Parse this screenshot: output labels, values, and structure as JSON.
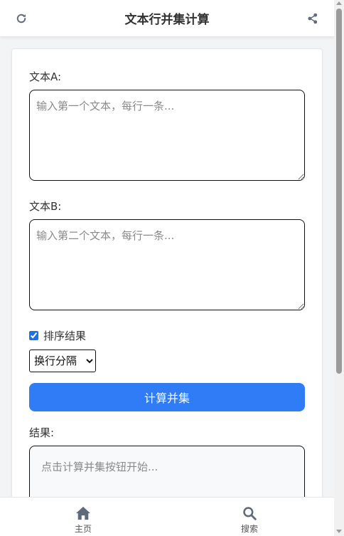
{
  "header": {
    "title": "文本行并集计算",
    "refresh_icon": "refresh-icon",
    "share_icon": "share-icon"
  },
  "form": {
    "text_a_label": "文本A:",
    "text_a_placeholder": "输入第一个文本，每行一条...",
    "text_a_value": "",
    "text_b_label": "文本B:",
    "text_b_placeholder": "输入第二个文本，每行一条...",
    "text_b_value": "",
    "sort_label": "排序结果",
    "sort_checked": true,
    "separator_selected": "换行分隔",
    "compute_button": "计算并集",
    "result_label": "结果:",
    "result_placeholder": "点击计算并集按钮开始..."
  },
  "bottom_nav": {
    "items": [
      {
        "label": "主页",
        "icon": "home-icon"
      },
      {
        "label": "搜索",
        "icon": "search-icon"
      }
    ]
  },
  "colors": {
    "accent": "#2f7cf6",
    "icon": "#5f6b7a"
  }
}
